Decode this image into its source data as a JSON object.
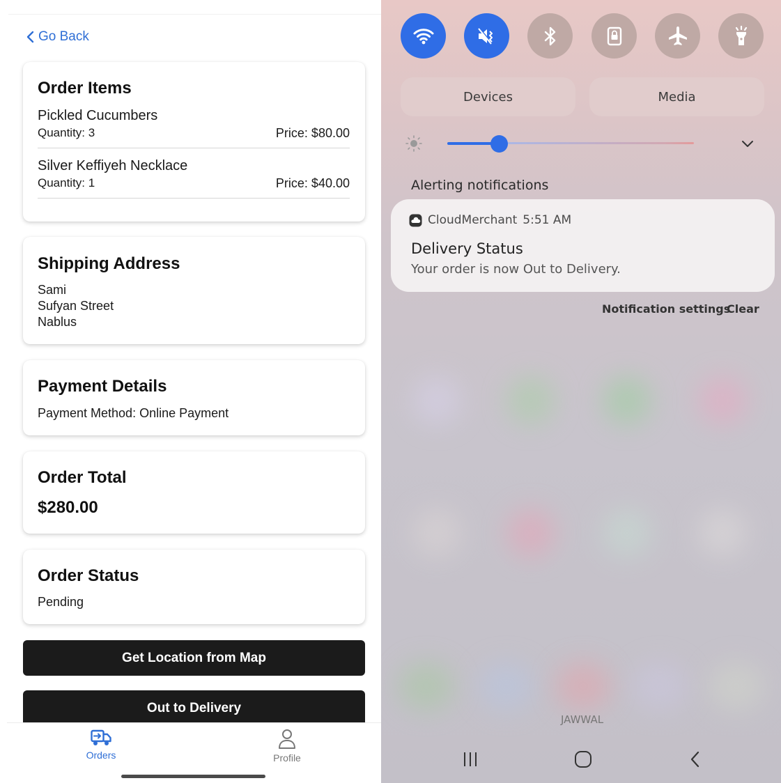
{
  "order_app": {
    "go_back": "Go Back",
    "order_items": {
      "title": "Order Items",
      "items": [
        {
          "name": "Pickled Cucumbers",
          "quantity": "Quantity: 3",
          "price": "Price: $80.00"
        },
        {
          "name": "Silver Keffiyeh Necklace",
          "quantity": "Quantity: 1",
          "price": "Price: $40.00"
        }
      ]
    },
    "shipping": {
      "title": "Shipping Address",
      "lines": [
        "Sami",
        "Sufyan Street",
        "Nablus"
      ]
    },
    "payment": {
      "title": "Payment Details",
      "method": "Payment Method: Online Payment"
    },
    "total": {
      "title": "Order Total",
      "amount": "$280.00"
    },
    "status": {
      "title": "Order Status",
      "value": "Pending"
    },
    "buttons": {
      "get_location": "Get Location from Map",
      "out_to_delivery": "Out to Delivery"
    },
    "bottom_nav": {
      "orders": "Orders",
      "profile": "Profile",
      "active": "orders"
    },
    "colors": {
      "accent": "#2f6fd6",
      "button": "#1b1b1b"
    }
  },
  "notification_shade": {
    "quick_settings": [
      {
        "icon": "wifi-icon",
        "state": "on"
      },
      {
        "icon": "sound-off-icon",
        "state": "on"
      },
      {
        "icon": "bluetooth-icon",
        "state": "off"
      },
      {
        "icon": "lock-rotation-icon",
        "state": "off"
      },
      {
        "icon": "airplane-icon",
        "state": "off"
      },
      {
        "icon": "flashlight-icon",
        "state": "off"
      }
    ],
    "devices_label": "Devices",
    "media_label": "Media",
    "brightness_level": 0.21,
    "section_label": "Alerting notifications",
    "notification": {
      "app_name": "CloudMerchant",
      "time": "5:51 AM",
      "title": "Delivery Status",
      "body": "Your order is now Out to Delivery."
    },
    "notification_settings_label": "Notification settings",
    "clear_label": "Clear",
    "carrier": "JAWWAL",
    "colors": {
      "qs_on": "#2f6de6",
      "qs_off": "#bfa9a5"
    }
  }
}
